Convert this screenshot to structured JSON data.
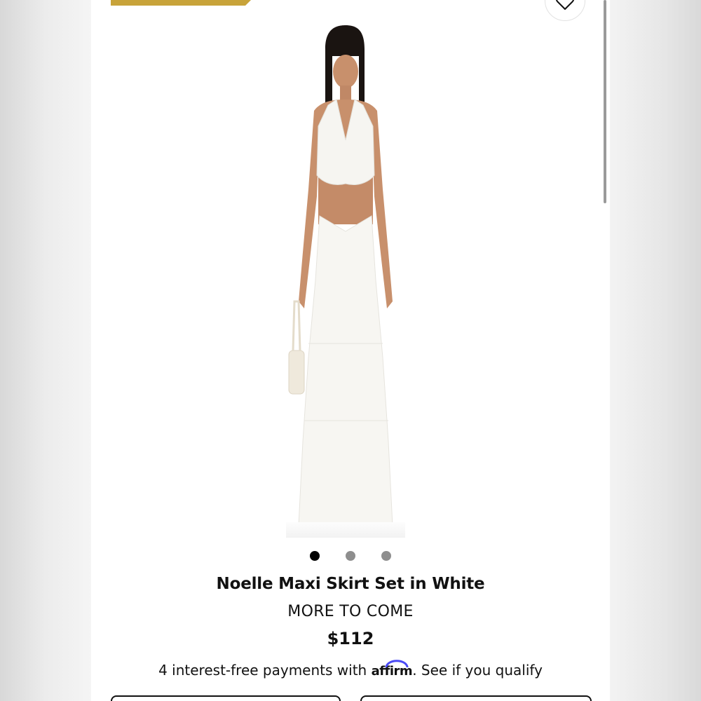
{
  "product": {
    "title": "Noelle Maxi Skirt Set in White",
    "brand": "MORE TO COME",
    "price": "$112"
  },
  "payments": {
    "prefix": "4 interest-free payments with",
    "provider": "affirm",
    "suffix": ". See if you qualify"
  },
  "gallery": {
    "image_count": 3,
    "active_index": 0
  },
  "colors": {
    "promo_accent": "#c8a33a",
    "affirm_arc": "#4a4af4",
    "text": "#111111",
    "dot_inactive": "#8e8e8e"
  },
  "icons": [
    "heart-icon",
    "affirm-logo"
  ]
}
